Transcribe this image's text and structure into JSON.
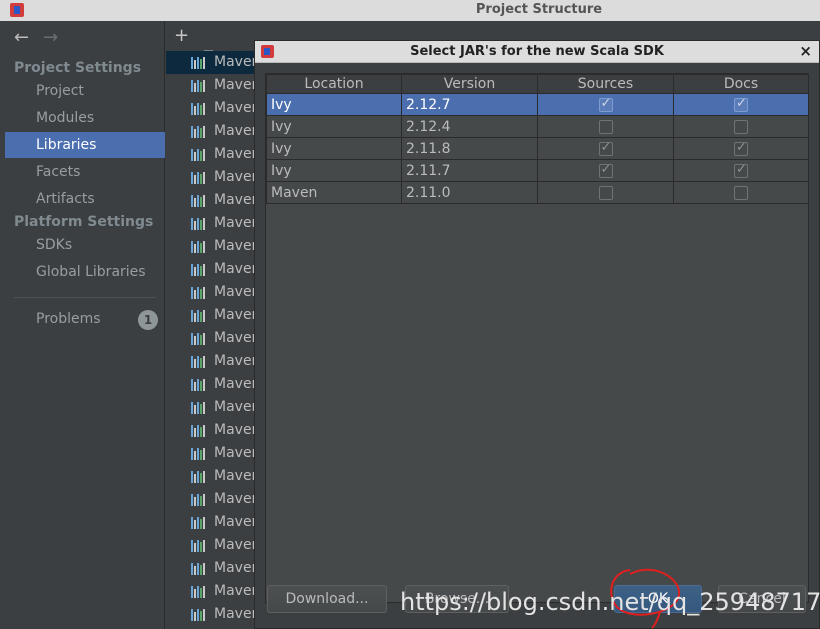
{
  "window": {
    "title": "Project Structure"
  },
  "nav": {
    "project_settings": "Project Settings",
    "platform_settings": "Platform Settings",
    "items": [
      "Project",
      "Modules",
      "Libraries",
      "Facets",
      "Artifacts"
    ],
    "platform_items": [
      "SDKs",
      "Global Libraries"
    ],
    "problems": "Problems",
    "problems_count": "1",
    "selected": "Libraries"
  },
  "libraries": {
    "toolbar": [
      "+",
      "−",
      "⧉"
    ],
    "item_label": "Maven",
    "rows": [
      "Maven",
      "Maven",
      "Maven",
      "Maven",
      "Maven",
      "Maven",
      "Maven",
      "Maven",
      "Maven",
      "Maven",
      "Maven",
      "Maven",
      "Maven",
      "Maven",
      "Maven",
      "Maven",
      "Maven",
      "Maven",
      "Maven",
      "Maven",
      "Maven",
      "Maven",
      "Maven",
      "Maven",
      "Maven"
    ]
  },
  "dialog": {
    "title": "Select JAR's for the new Scala SDK",
    "columns": [
      "Location",
      "Version",
      "Sources",
      "Docs"
    ],
    "rows": [
      {
        "location": "Ivy",
        "version": "2.12.7",
        "sources": true,
        "docs": true,
        "selected": true
      },
      {
        "location": "Ivy",
        "version": "2.12.4",
        "sources": false,
        "docs": false,
        "selected": false
      },
      {
        "location": "Ivy",
        "version": "2.11.8",
        "sources": true,
        "docs": true,
        "selected": false
      },
      {
        "location": "Ivy",
        "version": "2.11.7",
        "sources": true,
        "docs": true,
        "selected": false
      },
      {
        "location": "Maven",
        "version": "2.11.0",
        "sources": false,
        "docs": false,
        "selected": false
      }
    ],
    "buttons": {
      "download": "Download...",
      "browse": "Browse...",
      "ok": "OK",
      "cancel": "Cancel"
    }
  },
  "watermark": "https://blog.csdn.net/qq_25948717",
  "colors": {
    "selection": "#4b6eaf",
    "background": "#3c3f41",
    "annotation": "#e0201e"
  },
  "icons": {
    "back": "arrow-left-icon",
    "forward": "arrow-right-icon",
    "library": "library-bars-icon",
    "app": "intellij-icon"
  }
}
